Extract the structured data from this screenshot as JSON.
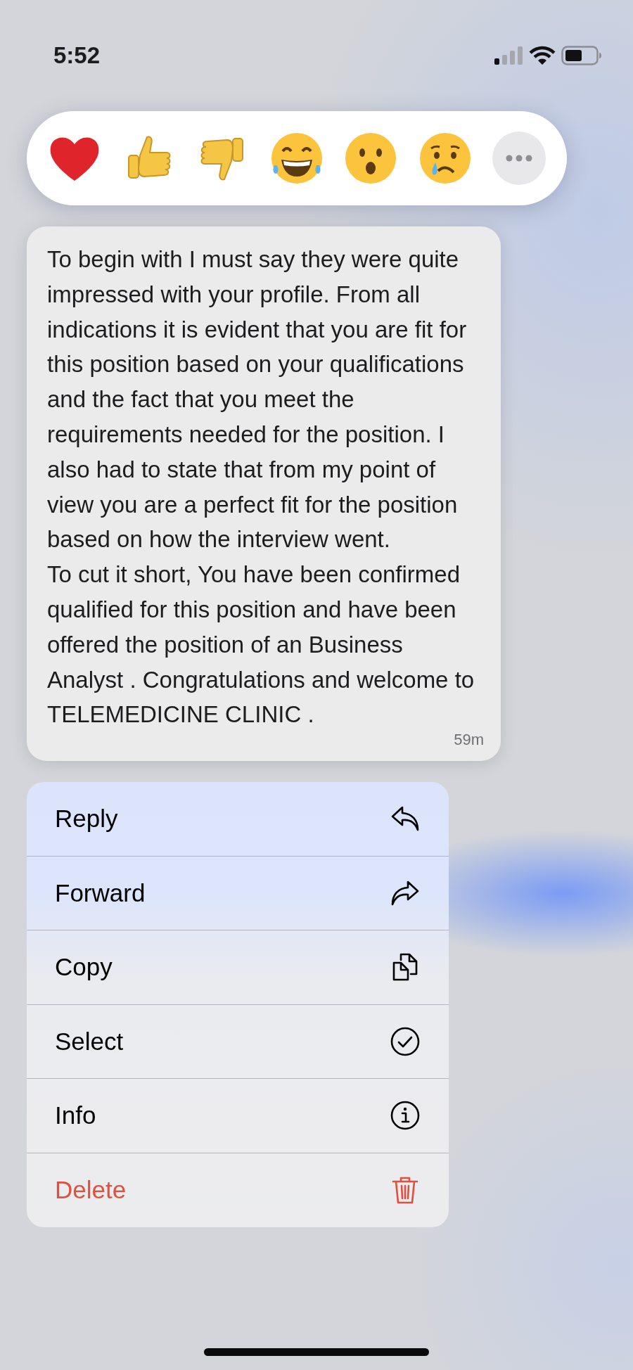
{
  "status_bar": {
    "time": "5:52"
  },
  "reactions": [
    {
      "kind": "heart"
    },
    {
      "kind": "thumbs_up"
    },
    {
      "kind": "thumbs_down"
    },
    {
      "kind": "laughing"
    },
    {
      "kind": "surprised"
    },
    {
      "kind": "sad"
    },
    {
      "kind": "more"
    }
  ],
  "message": {
    "paragraphs": [
      "To begin with I must say they were quite impressed with your profile. From all indications it is evident that you are fit for this position based on your qualifications and the fact that you meet the requirements needed for the position. I also had to state that from my point of view you are a perfect fit for the position based on how the interview went.",
      "To cut it short, You have been confirmed qualified for this position and have been offered the position of an Business Analyst . Congratulations and welcome to TELEMEDICINE CLINIC ."
    ],
    "time": "59m"
  },
  "menu": [
    {
      "label": "Reply",
      "kind": "reply",
      "destructive": false
    },
    {
      "label": "Forward",
      "kind": "forward",
      "destructive": false
    },
    {
      "label": "Copy",
      "kind": "copy",
      "destructive": false
    },
    {
      "label": "Select",
      "kind": "select",
      "destructive": false
    },
    {
      "label": "Info",
      "kind": "info",
      "destructive": false
    },
    {
      "label": "Delete",
      "kind": "delete",
      "destructive": true
    }
  ]
}
